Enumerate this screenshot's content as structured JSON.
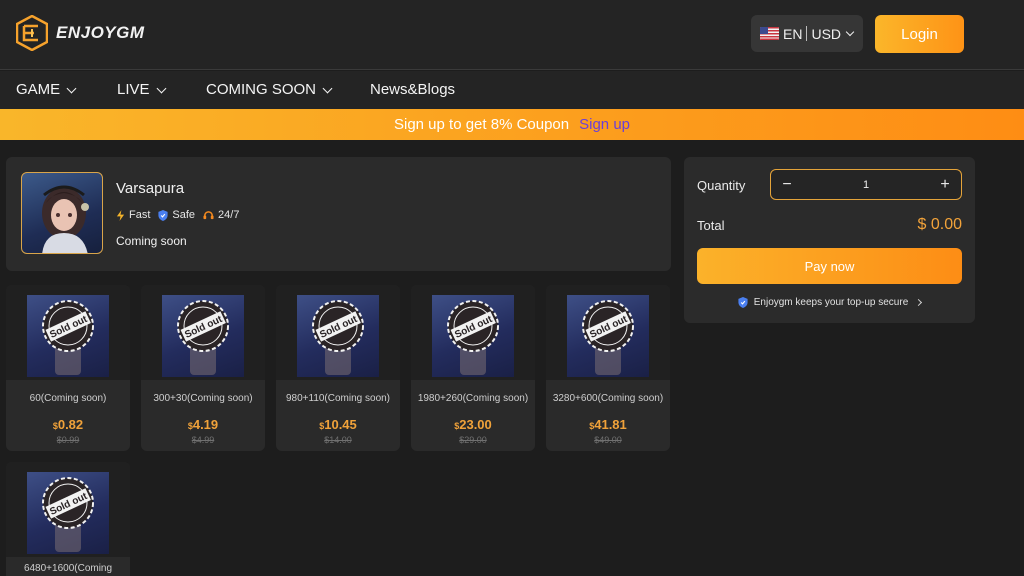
{
  "header": {
    "brand": "ENJOYGM",
    "language": "EN",
    "currency": "USD",
    "login_label": "Login"
  },
  "nav": {
    "items": [
      {
        "label": "GAME",
        "has_dropdown": true
      },
      {
        "label": "LIVE",
        "has_dropdown": true
      },
      {
        "label": "COMING SOON",
        "has_dropdown": true
      },
      {
        "label": "News&Blogs",
        "has_dropdown": false
      }
    ]
  },
  "banner": {
    "text": "Sign up to get 8% Coupon",
    "link": "Sign up"
  },
  "product": {
    "name": "Varsapura",
    "features": [
      "Fast",
      "Safe",
      "24/7"
    ],
    "status": "Coming soon"
  },
  "packages": [
    {
      "name": "60(Coming soon)",
      "currency": "$",
      "price": "0.82",
      "original": "$0.99",
      "stamp": "Sold out"
    },
    {
      "name": "300+30(Coming soon)",
      "currency": "$",
      "price": "4.19",
      "original": "$4.99",
      "stamp": "Sold out"
    },
    {
      "name": "980+110(Coming soon)",
      "currency": "$",
      "price": "10.45",
      "original": "$14.00",
      "stamp": "Sold out"
    },
    {
      "name": "1980+260(Coming soon)",
      "currency": "$",
      "price": "23.00",
      "original": "$29.00",
      "stamp": "Sold out"
    },
    {
      "name": "3280+600(Coming soon)",
      "currency": "$",
      "price": "41.81",
      "original": "$49.00",
      "stamp": "Sold out"
    },
    {
      "name": "6480+1600(Coming",
      "currency": "",
      "price": "",
      "original": "",
      "stamp": "Sold out"
    }
  ],
  "purchase": {
    "quantity_label": "Quantity",
    "quantity": "1",
    "minus": "−",
    "plus": "+",
    "total_label": "Total",
    "total": "$ 0.00",
    "pay_label": "Pay now",
    "secure_text": "Enjoygm keeps your top-up secure"
  },
  "colors": {
    "accent": "#fe9a1d",
    "price": "#f0a23a",
    "link": "#6b3fd9",
    "background": "#1d1d1d",
    "card": "#2b2b2b"
  }
}
